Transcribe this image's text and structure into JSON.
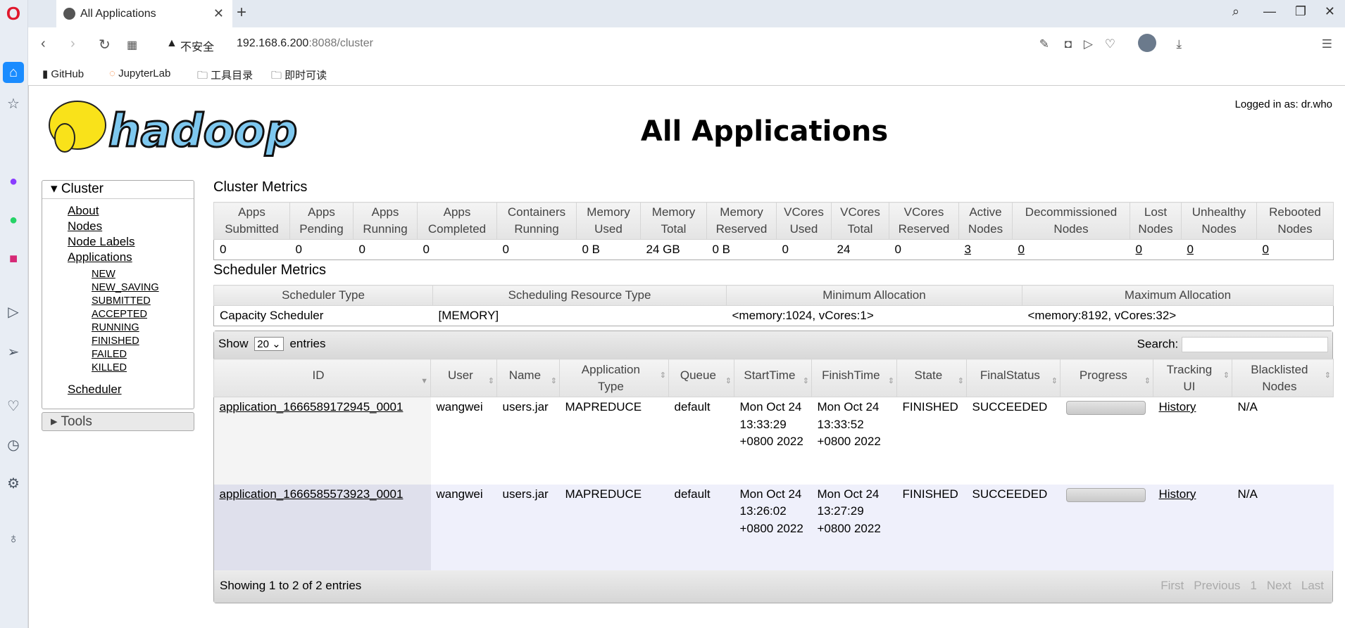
{
  "browser": {
    "tab_title": "All Applications",
    "url_host": "192.168.6.200",
    "url_rest": ":8088/cluster",
    "security": "不安全",
    "bookmarks": [
      "GitHub",
      "JupyterLab",
      "工具目录",
      "即时可读"
    ]
  },
  "header": {
    "title": "All Applications",
    "logged_in": "Logged in as: dr.who",
    "logo_text": "hadoop"
  },
  "nav": {
    "cluster": "Cluster",
    "items": [
      "About",
      "Nodes",
      "Node Labels",
      "Applications"
    ],
    "app_states": [
      "NEW",
      "NEW_SAVING",
      "SUBMITTED",
      "ACCEPTED",
      "RUNNING",
      "FINISHED",
      "FAILED",
      "KILLED"
    ],
    "scheduler": "Scheduler",
    "tools": "Tools"
  },
  "cluster_metrics": {
    "title": "Cluster Metrics",
    "headers": [
      [
        "Apps",
        "Submitted"
      ],
      [
        "Apps",
        "Pending"
      ],
      [
        "Apps",
        "Running"
      ],
      [
        "Apps",
        "Completed"
      ],
      [
        "Containers",
        "Running"
      ],
      [
        "Memory",
        "Used"
      ],
      [
        "Memory",
        "Total"
      ],
      [
        "Memory",
        "Reserved"
      ],
      [
        "VCores",
        "Used"
      ],
      [
        "VCores",
        "Total"
      ],
      [
        "VCores",
        "Reserved"
      ],
      [
        "Active",
        "Nodes"
      ],
      [
        "Decommissioned",
        "Nodes"
      ],
      [
        "Lost",
        "Nodes"
      ],
      [
        "Unhealthy",
        "Nodes"
      ],
      [
        "Rebooted",
        "Nodes"
      ]
    ],
    "values": [
      "0",
      "0",
      "0",
      "0",
      "0",
      "0 B",
      "24 GB",
      "0 B",
      "0",
      "24",
      "0",
      "3",
      "0",
      "0",
      "0",
      "0"
    ]
  },
  "scheduler_metrics": {
    "title": "Scheduler Metrics",
    "headers": [
      "Scheduler Type",
      "Scheduling Resource Type",
      "Minimum Allocation",
      "Maximum Allocation"
    ],
    "values": [
      "Capacity Scheduler",
      "[MEMORY]",
      "<memory:1024, vCores:1>",
      "<memory:8192, vCores:32>"
    ]
  },
  "apps": {
    "show": "Show",
    "entries_value": "20",
    "entries": "entries",
    "search": "Search:",
    "headers": [
      [
        "ID"
      ],
      [
        "User"
      ],
      [
        "Name"
      ],
      [
        "Application",
        "Type"
      ],
      [
        "Queue"
      ],
      [
        "StartTime"
      ],
      [
        "FinishTime"
      ],
      [
        "State"
      ],
      [
        "FinalStatus"
      ],
      [
        "Progress"
      ],
      [
        "Tracking",
        "UI"
      ],
      [
        "Blacklisted",
        "Nodes"
      ]
    ],
    "rows": [
      {
        "id": "application_1666589172945_0001",
        "user": "wangwei",
        "name": "users.jar",
        "type": "MAPREDUCE",
        "queue": "default",
        "start": "Mon Oct 24 13:33:29 +0800 2022",
        "finish": "Mon Oct 24 13:33:52 +0800 2022",
        "state": "FINISHED",
        "final": "SUCCEEDED",
        "progress": 100,
        "tracking": "History",
        "blacklisted": "N/A"
      },
      {
        "id": "application_1666585573923_0001",
        "user": "wangwei",
        "name": "users.jar",
        "type": "MAPREDUCE",
        "queue": "default",
        "start": "Mon Oct 24 13:26:02 +0800 2022",
        "finish": "Mon Oct 24 13:27:29 +0800 2022",
        "state": "FINISHED",
        "final": "SUCCEEDED",
        "progress": 100,
        "tracking": "History",
        "blacklisted": "N/A"
      }
    ],
    "showing": "Showing 1 to 2 of 2 entries",
    "pager": [
      "First",
      "Previous",
      "1",
      "Next",
      "Last"
    ]
  }
}
